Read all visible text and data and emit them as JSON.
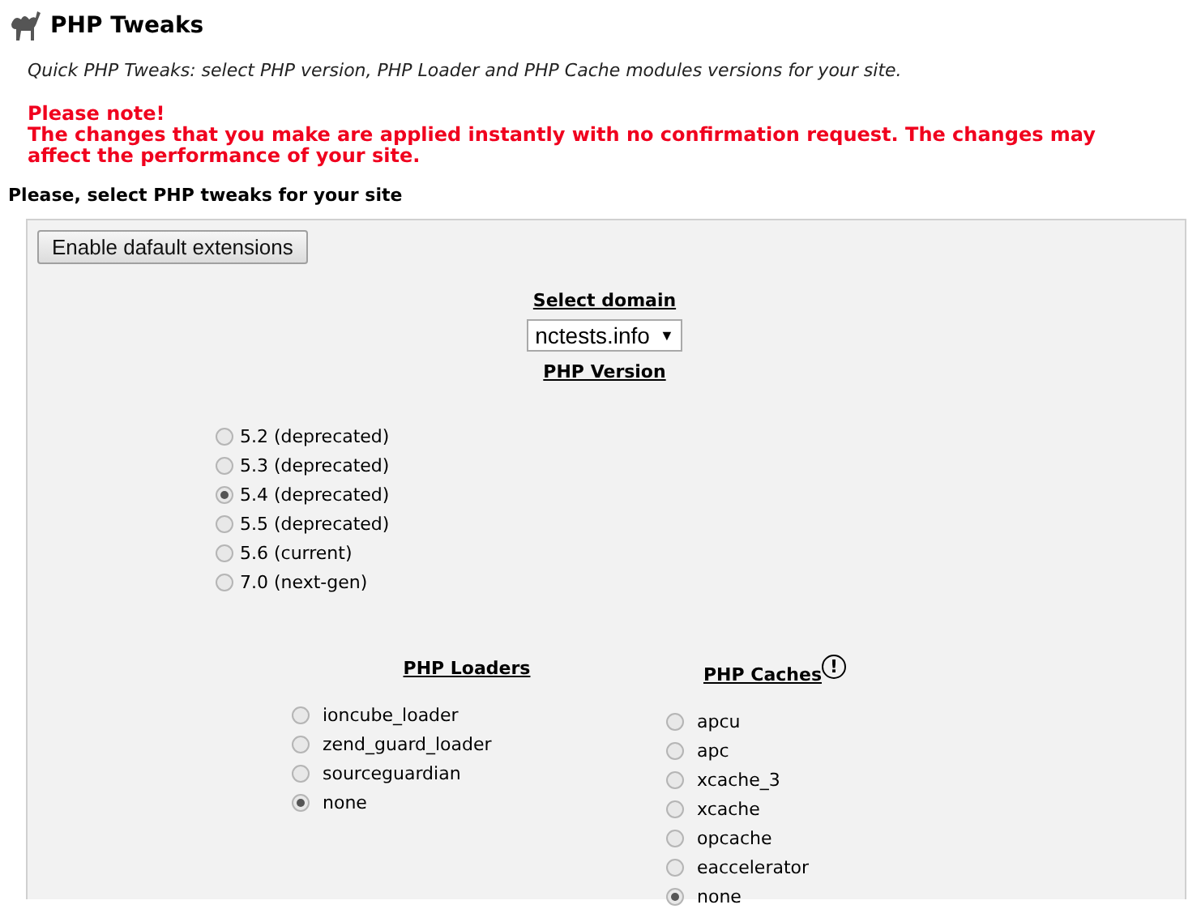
{
  "header": {
    "title": "PHP Tweaks"
  },
  "description": "Quick PHP Tweaks: select PHP version, PHP Loader and PHP Cache modules versions for your site.",
  "notice": {
    "title": "Please note!",
    "text": "The changes that you make are applied instantly with no confirmation request. The changes may affect the performance of your site."
  },
  "section_title": "Please, select PHP tweaks for your site",
  "default_button": "Enable dafault extensions",
  "domain": {
    "heading": "Select domain",
    "value": "nctests.info",
    "arrow": "▼"
  },
  "php_version": {
    "heading": "PHP Version",
    "options": [
      {
        "label": "5.2 (deprecated)",
        "selected": false
      },
      {
        "label": "5.3 (deprecated)",
        "selected": false
      },
      {
        "label": "5.4 (deprecated)",
        "selected": true
      },
      {
        "label": "5.5 (deprecated)",
        "selected": false
      },
      {
        "label": "5.6 (current)",
        "selected": false
      },
      {
        "label": "7.0 (next-gen)",
        "selected": false
      }
    ]
  },
  "loaders": {
    "heading": "PHP Loaders",
    "options": [
      {
        "label": "ioncube_loader",
        "selected": false
      },
      {
        "label": "zend_guard_loader",
        "selected": false
      },
      {
        "label": "sourceguardian",
        "selected": false
      },
      {
        "label": "none",
        "selected": true
      }
    ]
  },
  "caches": {
    "heading": "PHP Caches",
    "info_icon": "!",
    "options": [
      {
        "label": "apcu",
        "selected": false
      },
      {
        "label": "apc",
        "selected": false
      },
      {
        "label": "xcache_3",
        "selected": false
      },
      {
        "label": "xcache",
        "selected": false
      },
      {
        "label": "opcache",
        "selected": false
      },
      {
        "label": "eaccelerator",
        "selected": false
      },
      {
        "label": "none",
        "selected": true
      }
    ]
  }
}
